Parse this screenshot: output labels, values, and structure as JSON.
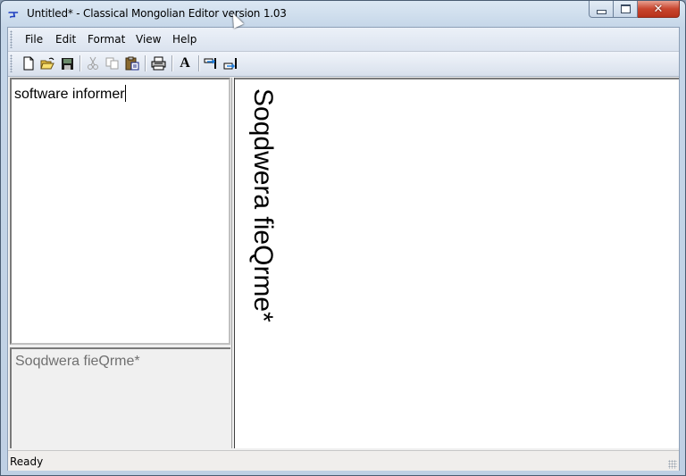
{
  "window": {
    "title": "Untitled* - Classical Mongolian Editor version 1.03",
    "app_icon": "mongolian-script-icon",
    "caption_buttons": {
      "minimize": "minimize-icon",
      "maximize": "maximize-icon",
      "close": "close-icon",
      "close_glyph": "✕"
    }
  },
  "menu": {
    "items": [
      {
        "label": "File"
      },
      {
        "label": "Edit"
      },
      {
        "label": "Format"
      },
      {
        "label": "View"
      },
      {
        "label": "Help"
      }
    ]
  },
  "toolbar": {
    "buttons": [
      {
        "name": "new",
        "icon": "new-document-icon",
        "enabled": true
      },
      {
        "name": "open",
        "icon": "open-folder-icon",
        "enabled": true
      },
      {
        "name": "save",
        "icon": "save-floppy-icon",
        "enabled": true
      },
      {
        "name": "cut",
        "icon": "scissors-icon",
        "enabled": false
      },
      {
        "name": "copy",
        "icon": "copy-icon",
        "enabled": false
      },
      {
        "name": "paste",
        "icon": "paste-clipboard-icon",
        "enabled": true
      },
      {
        "name": "print",
        "icon": "printer-icon",
        "enabled": true
      },
      {
        "name": "font",
        "icon": "font-icon",
        "glyph": "A",
        "enabled": true
      },
      {
        "name": "align-left",
        "icon": "text-direction-left-icon",
        "enabled": true
      },
      {
        "name": "align-right",
        "icon": "text-direction-right-icon",
        "enabled": true
      }
    ]
  },
  "editor": {
    "input_text": "software informer",
    "preview_text": "Soqdwera fieQrme*",
    "vertical_output": "Soqdwera fieQrme*"
  },
  "statusbar": {
    "text": "Ready"
  },
  "colors": {
    "close_button": "#c8452e",
    "title_icon": "#2040c0",
    "preview_text": "#707070"
  }
}
